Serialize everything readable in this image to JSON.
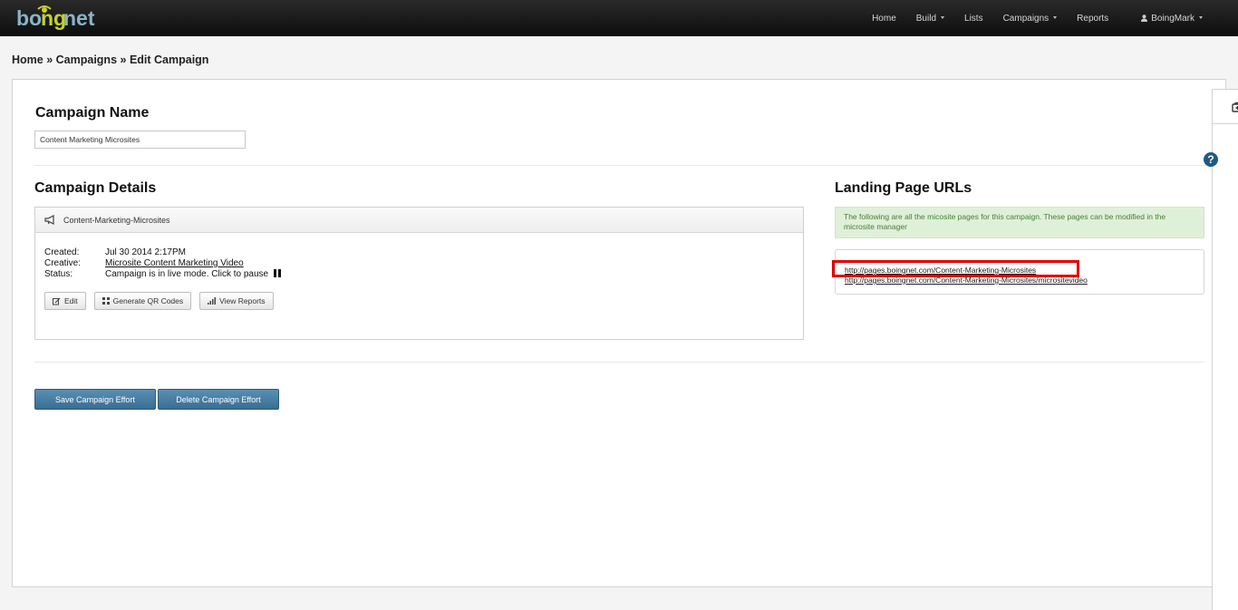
{
  "navbar": {
    "logo_text": "boingnet",
    "items": [
      {
        "label": "Home",
        "dropdown": false
      },
      {
        "label": "Build",
        "dropdown": true
      },
      {
        "label": "Lists",
        "dropdown": false
      },
      {
        "label": "Campaigns",
        "dropdown": true
      },
      {
        "label": "Reports",
        "dropdown": false
      }
    ],
    "user": {
      "label": "BoingMark",
      "icon": "user-icon",
      "dropdown": true
    }
  },
  "breadcrumb": {
    "home": "Home",
    "sep1": " » ",
    "campaigns": "Campaigns",
    "sep2": " » ",
    "current": "Edit Campaign"
  },
  "campaign_name": {
    "heading": "Campaign Name",
    "value": "Content Marketing Microsites"
  },
  "campaign_details": {
    "heading": "Campaign Details",
    "box_title": "Content-Marketing-Microsites",
    "box_icon": "megaphone-icon",
    "created_label": "Created:",
    "created_value": "Jul 30 2014 2:17PM",
    "creative_label": "Creative:",
    "creative_value": "Microsite Content Marketing Video",
    "status_label": "Status:",
    "status_value": "Campaign is in live mode. Click to pause",
    "buttons": {
      "edit": "Edit",
      "qr": "Generate QR Codes",
      "reports": "View Reports"
    }
  },
  "landing_pages": {
    "heading": "Landing Page URLs",
    "info": "The following are all the micosite pages for this campaign. These pages can be modified in the microsite manager",
    "urls": [
      "http://pages.boingnet.com/Content-Marketing-Microsites",
      "http://pages.boingnet.com/Content-Marketing-Microsites/micrositevideo"
    ]
  },
  "actions": {
    "save": "Save Campaign Effort",
    "delete": "Delete Campaign Effort"
  },
  "help_label": "?",
  "colors": {
    "navbar_bg": "#111111",
    "primary_button": "#3f7399",
    "alert_bg": "#dff0d8",
    "highlight": "#e30000",
    "help": "#1f5a86"
  }
}
